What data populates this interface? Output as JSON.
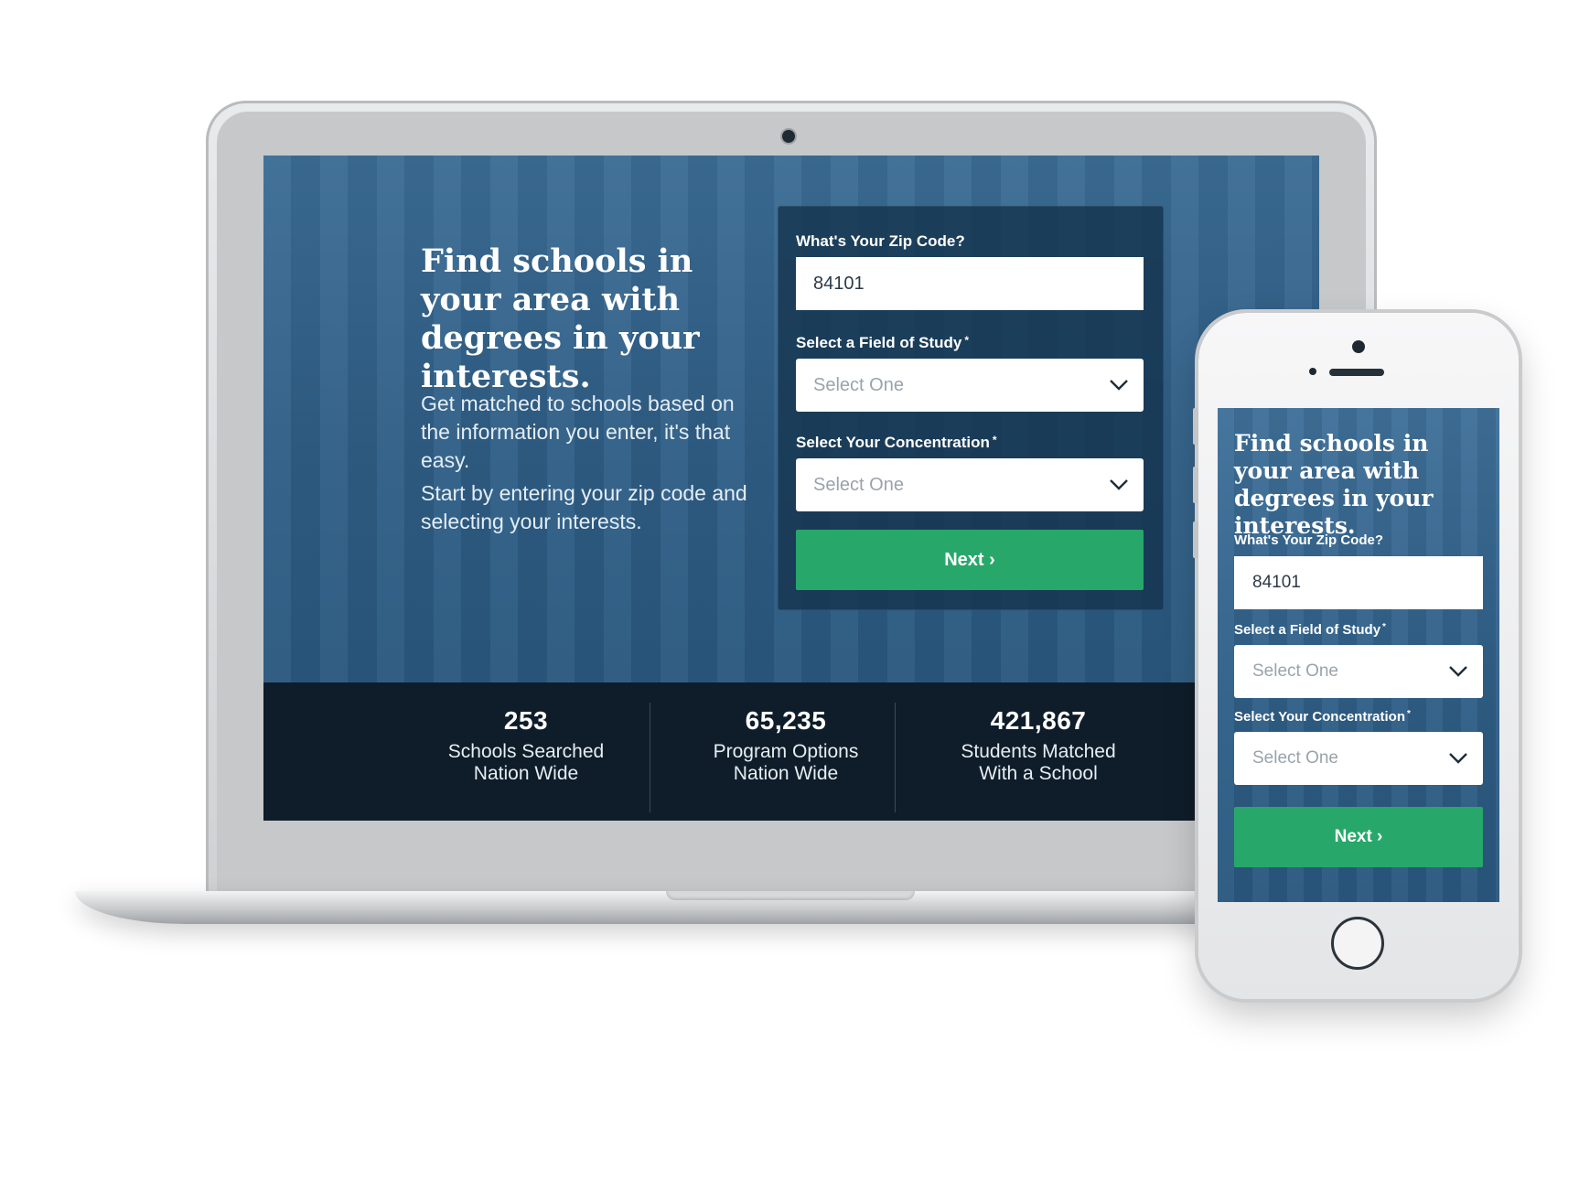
{
  "desktop": {
    "hero": {
      "title": "Find schools in your area with degrees in your interests.",
      "paragraph1": "Get matched to schools based on the information you enter, it's that easy.",
      "paragraph2": "Start by entering your zip code and selecting your interests."
    },
    "form": {
      "zip_label": "What's Your Zip Code?",
      "zip_value": "84101",
      "field_label": "Select a Field of Study",
      "field_value": "Select One",
      "concentration_label": "Select Your Concentration",
      "concentration_value": "Select One",
      "required_mark": "*",
      "next_label": "Next ›"
    },
    "stats": [
      {
        "number": "253",
        "label_line1": "Schools Searched",
        "label_line2": "Nation Wide"
      },
      {
        "number": "65,235",
        "label_line1": "Program Options",
        "label_line2": "Nation Wide"
      },
      {
        "number": "421,867",
        "label_line1": "Students Matched",
        "label_line2": "With a School"
      }
    ]
  },
  "mobile": {
    "title": "Find schools in your area with degrees in your interests.",
    "form": {
      "zip_label": "What's Your Zip Code?",
      "zip_value": "84101",
      "field_label": "Select a Field of Study",
      "field_value": "Select One",
      "concentration_label": "Select Your Concentration",
      "concentration_value": "Select One",
      "required_mark": "*",
      "next_label": "Next ›"
    }
  },
  "icons": {
    "select_arrow": "chevron-down-icon"
  },
  "colors": {
    "hero_blue": "#2f5e86",
    "form_card": "#15344e",
    "stats_bar": "#0f1d2a",
    "next_button": "#27a86a",
    "text_white": "#ffffff"
  }
}
